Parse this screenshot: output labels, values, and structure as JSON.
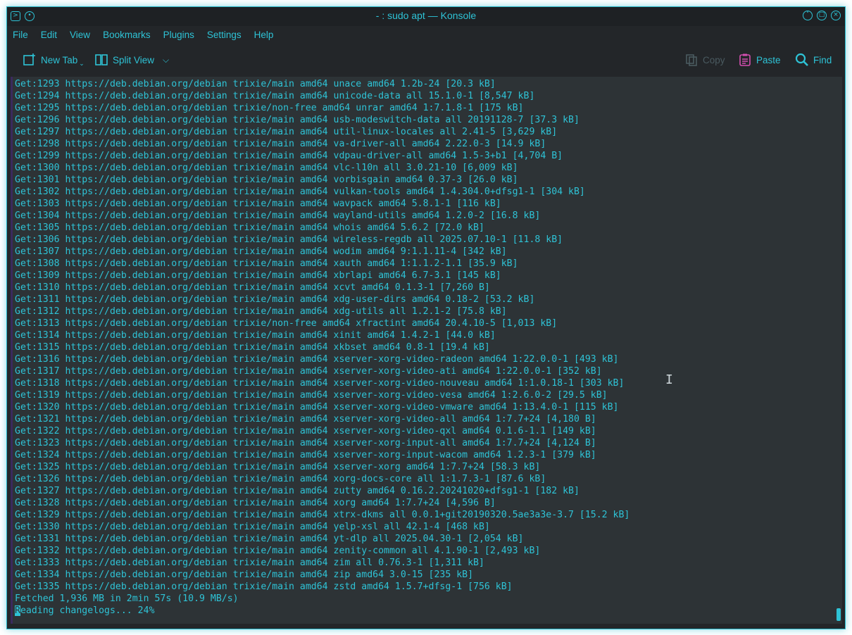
{
  "window": {
    "title": "- : sudo apt — Konsole"
  },
  "menubar": {
    "items": [
      "File",
      "Edit",
      "View",
      "Bookmarks",
      "Plugins",
      "Settings",
      "Help"
    ]
  },
  "toolbar": {
    "new_tab": "New Tab",
    "split_view": "Split View",
    "copy": "Copy",
    "paste": "Paste",
    "find": "Find"
  },
  "colors": {
    "accent": "#2ec3d6",
    "background": "#2d3336"
  },
  "terminal": {
    "lines": [
      "Get:1293 https://deb.debian.org/debian trixie/main amd64 unace amd64 1.2b-24 [20.3 kB]",
      "Get:1294 https://deb.debian.org/debian trixie/main amd64 unicode-data all 15.1.0-1 [8,547 kB]",
      "Get:1295 https://deb.debian.org/debian trixie/non-free amd64 unrar amd64 1:7.1.8-1 [175 kB]",
      "Get:1296 https://deb.debian.org/debian trixie/main amd64 usb-modeswitch-data all 20191128-7 [37.3 kB]",
      "Get:1297 https://deb.debian.org/debian trixie/main amd64 util-linux-locales all 2.41-5 [3,629 kB]",
      "Get:1298 https://deb.debian.org/debian trixie/main amd64 va-driver-all amd64 2.22.0-3 [14.9 kB]",
      "Get:1299 https://deb.debian.org/debian trixie/main amd64 vdpau-driver-all amd64 1.5-3+b1 [4,704 B]",
      "Get:1300 https://deb.debian.org/debian trixie/main amd64 vlc-l10n all 3.0.21-10 [6,009 kB]",
      "Get:1301 https://deb.debian.org/debian trixie/main amd64 vorbisgain amd64 0.37-3 [26.0 kB]",
      "Get:1302 https://deb.debian.org/debian trixie/main amd64 vulkan-tools amd64 1.4.304.0+dfsg1-1 [304 kB]",
      "Get:1303 https://deb.debian.org/debian trixie/main amd64 wavpack amd64 5.8.1-1 [116 kB]",
      "Get:1304 https://deb.debian.org/debian trixie/main amd64 wayland-utils amd64 1.2.0-2 [16.8 kB]",
      "Get:1305 https://deb.debian.org/debian trixie/main amd64 whois amd64 5.6.2 [72.0 kB]",
      "Get:1306 https://deb.debian.org/debian trixie/main amd64 wireless-regdb all 2025.07.10-1 [11.8 kB]",
      "Get:1307 https://deb.debian.org/debian trixie/main amd64 wodim amd64 9:1.1.11-4 [342 kB]",
      "Get:1308 https://deb.debian.org/debian trixie/main amd64 xauth amd64 1:1.1.2-1.1 [35.9 kB]",
      "Get:1309 https://deb.debian.org/debian trixie/main amd64 xbrlapi amd64 6.7-3.1 [145 kB]",
      "Get:1310 https://deb.debian.org/debian trixie/main amd64 xcvt amd64 0.1.3-1 [7,260 B]",
      "Get:1311 https://deb.debian.org/debian trixie/main amd64 xdg-user-dirs amd64 0.18-2 [53.2 kB]",
      "Get:1312 https://deb.debian.org/debian trixie/main amd64 xdg-utils all 1.2.1-2 [75.8 kB]",
      "Get:1313 https://deb.debian.org/debian trixie/non-free amd64 xfractint amd64 20.4.10-5 [1,013 kB]",
      "Get:1314 https://deb.debian.org/debian trixie/main amd64 xinit amd64 1.4.2-1 [44.0 kB]",
      "Get:1315 https://deb.debian.org/debian trixie/main amd64 xkbset amd64 0.8-1 [19.4 kB]",
      "Get:1316 https://deb.debian.org/debian trixie/main amd64 xserver-xorg-video-radeon amd64 1:22.0.0-1 [493 kB]",
      "Get:1317 https://deb.debian.org/debian trixie/main amd64 xserver-xorg-video-ati amd64 1:22.0.0-1 [352 kB]",
      "Get:1318 https://deb.debian.org/debian trixie/main amd64 xserver-xorg-video-nouveau amd64 1:1.0.18-1 [303 kB]",
      "Get:1319 https://deb.debian.org/debian trixie/main amd64 xserver-xorg-video-vesa amd64 1:2.6.0-2 [29.5 kB]",
      "Get:1320 https://deb.debian.org/debian trixie/main amd64 xserver-xorg-video-vmware amd64 1:13.4.0-1 [115 kB]",
      "Get:1321 https://deb.debian.org/debian trixie/main amd64 xserver-xorg-video-all amd64 1:7.7+24 [4,180 B]",
      "Get:1322 https://deb.debian.org/debian trixie/main amd64 xserver-xorg-video-qxl amd64 0.1.6-1.1 [149 kB]",
      "Get:1323 https://deb.debian.org/debian trixie/main amd64 xserver-xorg-input-all amd64 1:7.7+24 [4,124 B]",
      "Get:1324 https://deb.debian.org/debian trixie/main amd64 xserver-xorg-input-wacom amd64 1.2.3-1 [379 kB]",
      "Get:1325 https://deb.debian.org/debian trixie/main amd64 xserver-xorg amd64 1:7.7+24 [58.3 kB]",
      "Get:1326 https://deb.debian.org/debian trixie/main amd64 xorg-docs-core all 1:1.7.3-1 [87.6 kB]",
      "Get:1327 https://deb.debian.org/debian trixie/main amd64 zutty amd64 0.16.2.20241020+dfsg1-1 [182 kB]",
      "Get:1328 https://deb.debian.org/debian trixie/main amd64 xorg amd64 1:7.7+24 [4,596 B]",
      "Get:1329 https://deb.debian.org/debian trixie/main amd64 xtrx-dkms all 0.0.1+git20190320.5ae3a3e-3.7 [15.2 kB]",
      "Get:1330 https://deb.debian.org/debian trixie/main amd64 yelp-xsl all 42.1-4 [468 kB]",
      "Get:1331 https://deb.debian.org/debian trixie/main amd64 yt-dlp all 2025.04.30-1 [2,054 kB]",
      "Get:1332 https://deb.debian.org/debian trixie/main amd64 zenity-common all 4.1.90-1 [2,493 kB]",
      "Get:1333 https://deb.debian.org/debian trixie/main amd64 zim all 0.76.3-1 [1,311 kB]",
      "Get:1334 https://deb.debian.org/debian trixie/main amd64 zip amd64 3.0-15 [235 kB]",
      "Get:1335 https://deb.debian.org/debian trixie/main amd64 zstd amd64 1.5.7+dfsg-1 [756 kB]",
      "Fetched 1,936 MB in 2min 57s (10.9 MB/s)"
    ],
    "cursor_char": "R",
    "last_line_rest": "eading changelogs... 24%"
  }
}
